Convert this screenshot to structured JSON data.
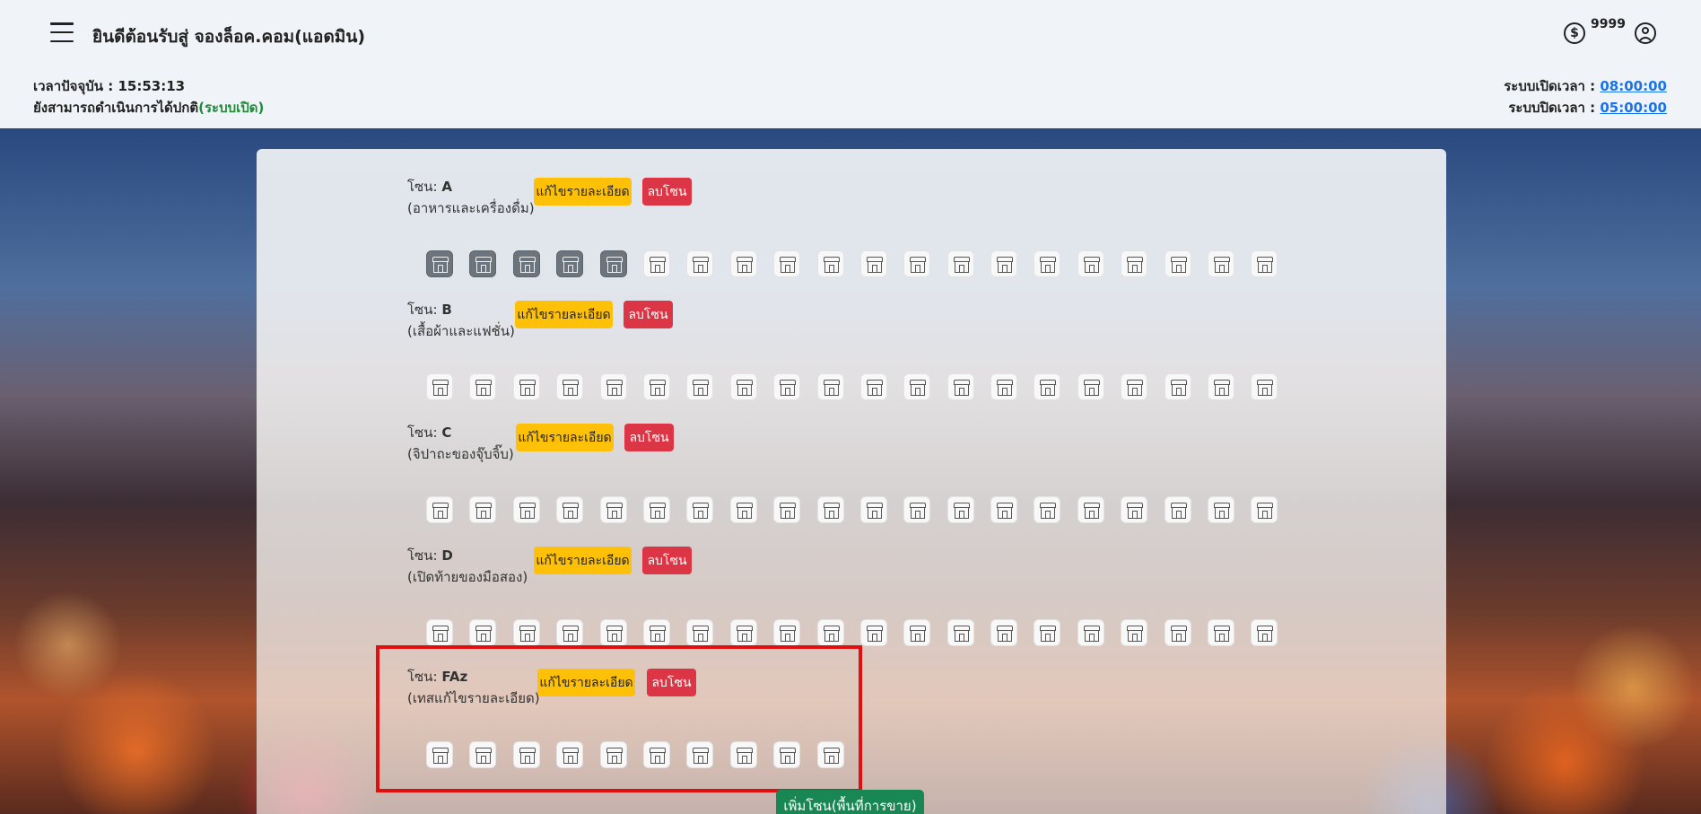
{
  "header": {
    "title": "ยินดีต้อนรับสู่ จองล็อค.คอม(แอดมิน)",
    "coin_symbol": "$",
    "coins": "9999",
    "current_time_label": "เวลาปัจจุบัน : 15:53:13",
    "status_prefix": "ยังสามารถดำเนินการได้ปกติ",
    "status_open": "(ระบบเปิด)",
    "open_label": "ระบบเปิดเวลา : ",
    "open_time": "08:00:00",
    "close_label": "ระบบปิดเวลา : ",
    "close_time": "05:00:00"
  },
  "zone_prefix": "โซน: ",
  "edit_label": "แก้ไขรายละเอียด",
  "delete_label": "ลบโซน",
  "add_zone_label": "เพิ่มโซน(พื้นที่การขาย)",
  "zones": [
    {
      "code": "A",
      "desc": "(อาหารและเครื่องดื่ม)",
      "stalls": 20,
      "occupied": 5
    },
    {
      "code": "B",
      "desc": "(เสื้อผ้าและแฟชั่น)",
      "stalls": 20,
      "occupied": 0
    },
    {
      "code": "C",
      "desc": "(จิปาถะของจุ๊บจิ๊บ)",
      "stalls": 20,
      "occupied": 0
    },
    {
      "code": "D",
      "desc": "(เปิดท้ายของมือสอง)",
      "stalls": 20,
      "occupied": 0
    },
    {
      "code": "FAz",
      "desc": "(เทสแก้ไขรายละเอียด)",
      "stalls": 10,
      "occupied": 0
    }
  ],
  "icons": {
    "menu": "hamburger-menu-icon",
    "coin": "dollar-coin-icon",
    "user": "user-circle-icon",
    "stall": "store-icon"
  }
}
